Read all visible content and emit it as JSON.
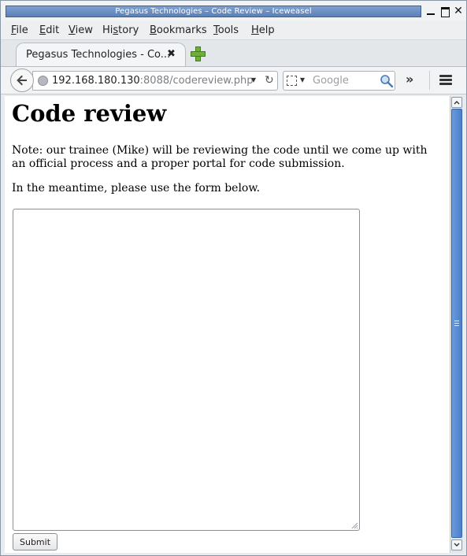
{
  "window": {
    "title": "Pegasus Technologies – Code Review – Iceweasel"
  },
  "menubar": {
    "items": [
      {
        "label": "File",
        "accel": "F",
        "rest": "ile"
      },
      {
        "label": "Edit",
        "accel": "E",
        "rest": "dit"
      },
      {
        "label": "View",
        "accel": "V",
        "rest": "iew"
      },
      {
        "label": "History",
        "accel": "",
        "pre": "Hi",
        "accel2": "s",
        "rest": "tory"
      },
      {
        "label": "Bookmarks",
        "accel": "B",
        "rest": "ookmarks"
      },
      {
        "label": "Tools",
        "accel": "T",
        "rest": "ools"
      },
      {
        "label": "Help",
        "accel": "H",
        "rest": "elp"
      }
    ]
  },
  "tabs": [
    {
      "label": "Pegasus Technologies - Co...",
      "close": "✖"
    }
  ],
  "navbar": {
    "url_host": "192.168.180.130",
    "url_path": ":8088/codereview.php",
    "search_placeholder": "Google",
    "overflow": "»"
  },
  "page": {
    "heading": "Code review",
    "note": "Note: our trainee (Mike) will be reviewing the code until we come up with an official process and a proper portal for code submission.",
    "meantime": "In the meantime, please use the form below.",
    "textarea_value": "",
    "submit_label": "Submit"
  },
  "colors": {
    "title_bar": "#6a8fc4",
    "scroll_thumb": "#5a8bd2",
    "new_tab_plus": "#6fae3a"
  }
}
